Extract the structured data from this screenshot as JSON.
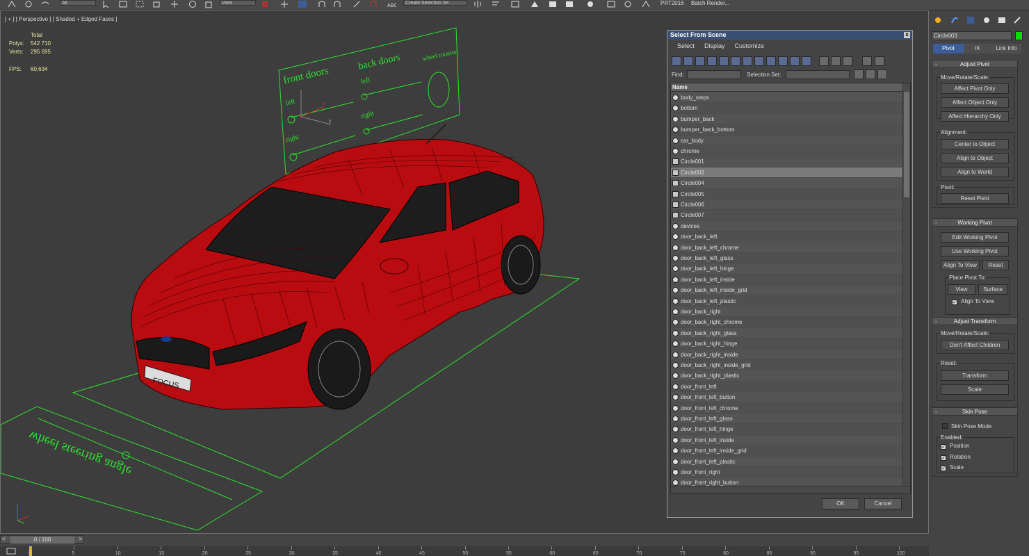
{
  "toolbar": {
    "drop1": "All",
    "drop2": "View",
    "drop3": "Create Selection Se",
    "prt_label": "PRT2016",
    "batch_label": "Batch Render..."
  },
  "viewport": {
    "label": "[ + ] [ Perspective ] [ Shaded + Edged Faces ]",
    "total_label": "Total",
    "polys_label": "Polys:",
    "polys_value": "542 710",
    "verts_label": "Verts:",
    "verts_value": "295 695",
    "fps_label": "FPS:",
    "fps_value": "60,634",
    "rig_front_doors": "front doors",
    "rig_back_doors": "back doors",
    "rig_wheel_rotation": "wheel rotation",
    "rig_left1": "left",
    "rig_left2": "left",
    "rig_right1": "right",
    "rig_right2": "right",
    "rig_steering": "wheel steering angle",
    "plate": "FOCUS",
    "axis_x": "x",
    "axis_y": "y",
    "axis_z": "z"
  },
  "dialog": {
    "title": "Select From Scene",
    "close": "x",
    "menu": [
      "Select",
      "Display",
      "Customize"
    ],
    "find_label": "Find:",
    "selection_set_label": "Selection Set:",
    "column_name": "Name",
    "selected_index": 7,
    "items": [
      {
        "name": "body_steps",
        "kind": "mesh"
      },
      {
        "name": "bottom",
        "kind": "mesh"
      },
      {
        "name": "bumper_back",
        "kind": "mesh"
      },
      {
        "name": "bumper_back_bottom",
        "kind": "mesh"
      },
      {
        "name": "car_body",
        "kind": "mesh"
      },
      {
        "name": "chrome",
        "kind": "mesh"
      },
      {
        "name": "Circle001",
        "kind": "shape"
      },
      {
        "name": "Circle003",
        "kind": "shape"
      },
      {
        "name": "Circle004",
        "kind": "shape"
      },
      {
        "name": "Circle005",
        "kind": "shape"
      },
      {
        "name": "Circle006",
        "kind": "shape"
      },
      {
        "name": "Circle007",
        "kind": "shape"
      },
      {
        "name": "devices",
        "kind": "mesh"
      },
      {
        "name": "door_back_left",
        "kind": "mesh"
      },
      {
        "name": "door_back_left_chrome",
        "kind": "mesh"
      },
      {
        "name": "door_back_left_glass",
        "kind": "mesh"
      },
      {
        "name": "door_back_left_hinge",
        "kind": "mesh"
      },
      {
        "name": "door_back_left_inside",
        "kind": "mesh"
      },
      {
        "name": "door_back_left_inside_grid",
        "kind": "mesh"
      },
      {
        "name": "door_back_left_plastic",
        "kind": "mesh"
      },
      {
        "name": "door_back_right",
        "kind": "mesh"
      },
      {
        "name": "door_back_right_chrome",
        "kind": "mesh"
      },
      {
        "name": "door_back_right_glass",
        "kind": "mesh"
      },
      {
        "name": "door_back_right_hinge",
        "kind": "mesh"
      },
      {
        "name": "door_back_right_inside",
        "kind": "mesh"
      },
      {
        "name": "door_back_right_inside_grid",
        "kind": "mesh"
      },
      {
        "name": "door_back_right_plastic",
        "kind": "mesh"
      },
      {
        "name": "door_front_left",
        "kind": "mesh"
      },
      {
        "name": "door_front_left_button",
        "kind": "mesh"
      },
      {
        "name": "door_front_left_chrome",
        "kind": "mesh"
      },
      {
        "name": "door_front_left_glass",
        "kind": "mesh"
      },
      {
        "name": "door_front_left_hinge",
        "kind": "mesh"
      },
      {
        "name": "door_front_left_inside",
        "kind": "mesh"
      },
      {
        "name": "door_front_left_inside_grid",
        "kind": "mesh"
      },
      {
        "name": "door_front_left_plastic",
        "kind": "mesh"
      },
      {
        "name": "door_front_right",
        "kind": "mesh"
      },
      {
        "name": "door_front_right_button",
        "kind": "mesh"
      }
    ],
    "ok": "OK",
    "cancel": "Cancel"
  },
  "cmdpanel": {
    "object_name": "Circle003",
    "object_color": "#00e000",
    "tab_pivot": "Pivot",
    "tab_ik": "IK",
    "tab_linkinfo": "Link Info",
    "adjust_pivot": "Adjust Pivot",
    "move_rotate_scale": "Move/Rotate/Scale:",
    "affect_pivot_only": "Affect Pivot Only",
    "affect_object_only": "Affect Object Only",
    "affect_hierarchy_only": "Affect Hierarchy Only",
    "alignment": "Alignment:",
    "center_to_object": "Center to Object",
    "align_to_object": "Align to Object",
    "align_to_world": "Align to World",
    "pivot": "Pivot:",
    "reset_pivot": "Reset Pivot",
    "working_pivot": "Working Pivot",
    "edit_working_pivot": "Edit Working Pivot",
    "use_working_pivot": "Use Working Pivot",
    "align_to_view": "Align To View",
    "reset": "Reset",
    "place_pivot_to": "Place Pivot To:",
    "view": "View",
    "surface": "Surface",
    "align_to_view_chk": "Align To View",
    "adjust_transform": "Adjust Transform",
    "move_rotate_scale2": "Move/Rotate/Scale:",
    "dont_affect_children": "Don't Affect Children",
    "reset2": "Reset:",
    "transform": "Transform",
    "scale_btn": "Scale",
    "skin_pose": "Skin Pose",
    "skin_pose_mode": "Skin Pose Mode",
    "enabled": "Enabled:",
    "position": "Position",
    "rotation": "Rotation",
    "scale_chk": "Scale"
  },
  "timeline": {
    "frame": "0 / 100",
    "ticks": [
      "0",
      "5",
      "10",
      "15",
      "20",
      "25",
      "30",
      "35",
      "40",
      "45",
      "50",
      "55",
      "60",
      "65",
      "70",
      "75",
      "80",
      "85",
      "90",
      "95",
      "100"
    ]
  },
  "colors": {
    "car_red": "#b80c10",
    "rig_green": "#2ee22e",
    "selection_blue": "#3d5d9a"
  }
}
